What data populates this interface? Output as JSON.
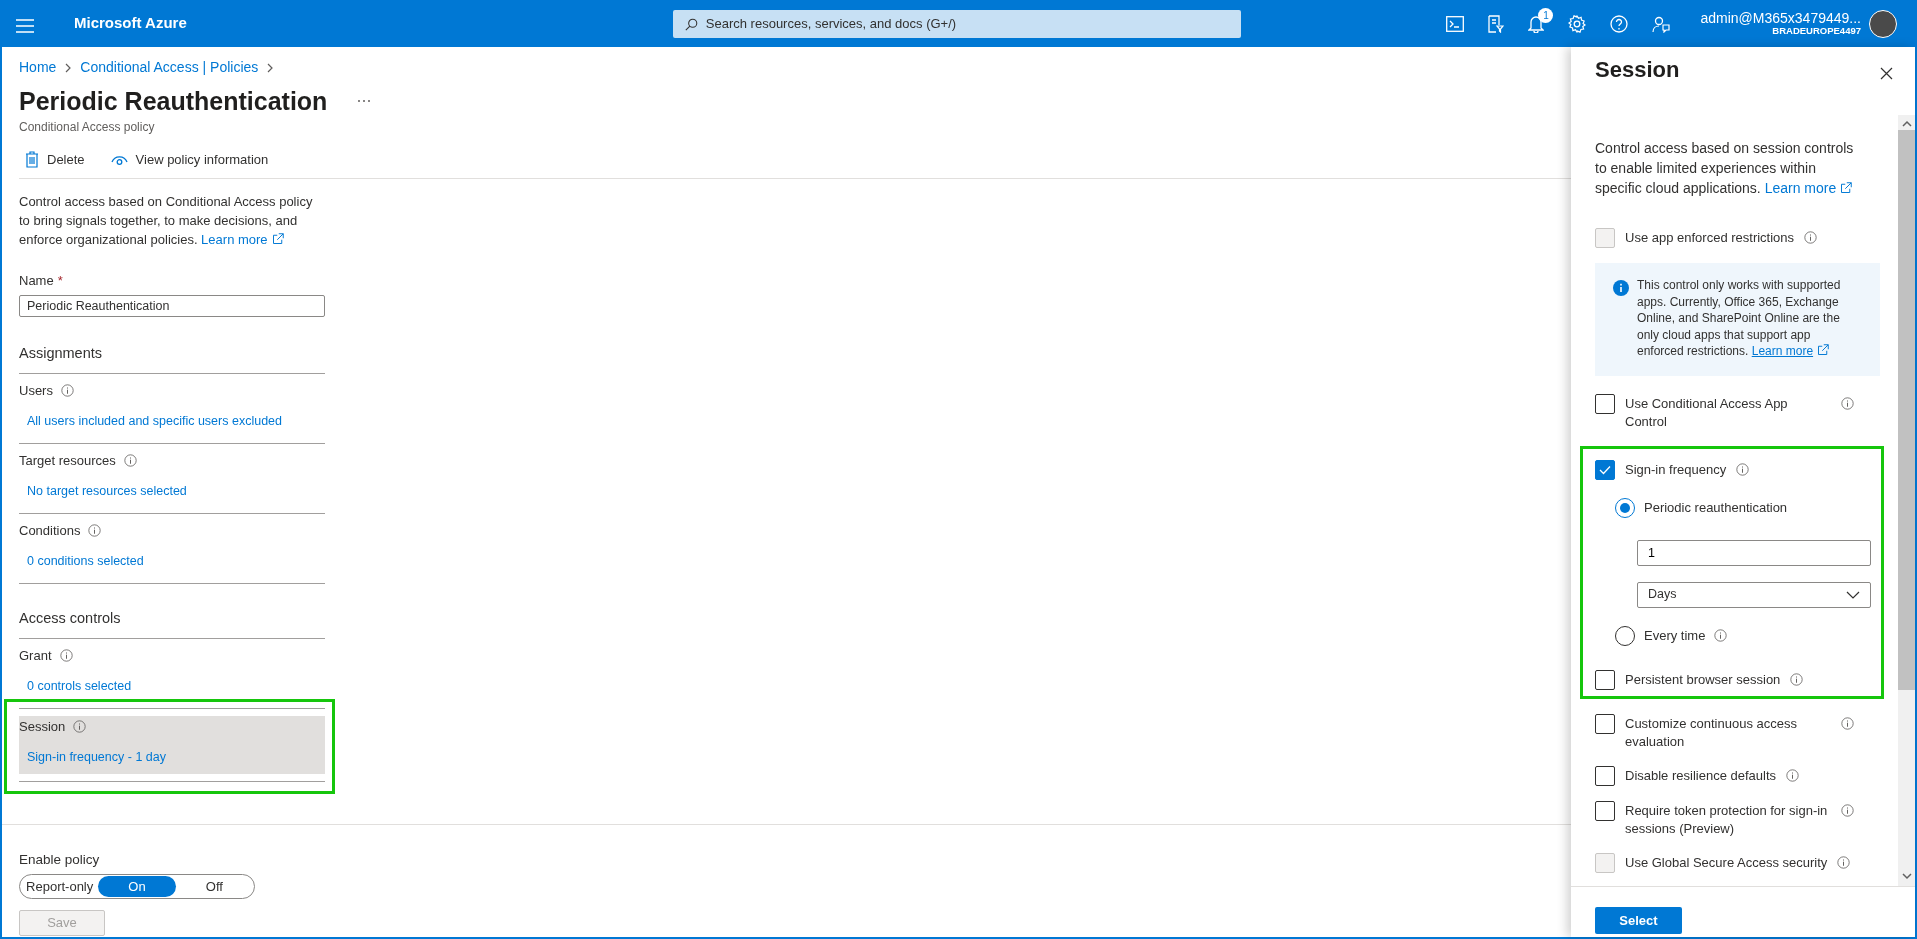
{
  "topbar": {
    "brand": "Microsoft Azure",
    "search": {
      "placeholder": "Search resources, services, and docs (G+/)"
    },
    "notification_count": "1",
    "account": {
      "name": "admin@M365x3479449...",
      "tenant": "BRADEUROPE4497"
    }
  },
  "breadcrumb": [
    {
      "label": "Home"
    },
    {
      "label": "Conditional Access | Policies"
    }
  ],
  "page": {
    "title": "Periodic Reauthentication",
    "subtitle": "Conditional Access policy"
  },
  "toolbar": [
    {
      "kind": "delete",
      "label": "Delete"
    },
    {
      "kind": "view",
      "label": "View policy information"
    }
  ],
  "description": {
    "text": "Control access based on Conditional Access policy to bring signals together, to make decisions, and enforce organizational policies. ",
    "link": "Learn more"
  },
  "name_field": {
    "label": "Name",
    "required_mark": "*",
    "value": "Periodic Reauthentication"
  },
  "sections": [
    {
      "heading": "Assignments",
      "items": [
        {
          "label": "Users",
          "value": "All users included and specific users excluded",
          "selected": false,
          "highlighted": false
        },
        {
          "label": "Target resources",
          "value": "No target resources selected",
          "selected": false,
          "highlighted": false
        },
        {
          "label": "Conditions",
          "value": "0 conditions selected",
          "selected": false,
          "highlighted": false
        }
      ]
    },
    {
      "heading": "Access controls",
      "items": [
        {
          "label": "Grant",
          "value": "0 controls selected",
          "selected": false,
          "highlighted": false
        },
        {
          "label": "Session",
          "value": "Sign-in frequency - 1 day",
          "selected": true,
          "highlighted": true
        }
      ]
    }
  ],
  "enable_policy": {
    "label": "Enable policy",
    "options": [
      {
        "label": "Report-only",
        "selected": false
      },
      {
        "label": "On",
        "selected": true
      },
      {
        "label": "Off",
        "selected": false
      }
    ]
  },
  "save_button": {
    "label": "Save",
    "disabled": true
  },
  "session_panel": {
    "title": "Session",
    "description": "Control access based on session controls to enable limited experiences within specific cloud applications. ",
    "link": "Learn more",
    "controls": [
      {
        "kind": "checkbox",
        "label": "Use app enforced restrictions",
        "checked": false,
        "disabled": true,
        "highlighted": false
      },
      {
        "kind": "notice",
        "text": "This control only works with supported apps. Currently, Office 365, Exchange Online, and SharePoint Online are the only cloud apps that support app enforced restrictions.",
        "link": "Learn more"
      },
      {
        "kind": "checkbox",
        "label": "Use Conditional Access App Control",
        "checked": false,
        "disabled": false,
        "highlighted": false
      },
      {
        "kind": "checkbox",
        "label": "Sign-in frequency",
        "checked": true,
        "disabled": false,
        "highlighted": true,
        "options": [
          {
            "label": "Periodic reauthentication",
            "selected": true,
            "value": "1",
            "unit": "Days",
            "info": false
          },
          {
            "label": "Every time",
            "selected": false,
            "info": true
          }
        ]
      },
      {
        "kind": "checkbox",
        "label": "Persistent browser session",
        "checked": false,
        "disabled": false,
        "highlighted": true
      },
      {
        "kind": "checkbox",
        "label": "Customize continuous access evaluation",
        "checked": false,
        "disabled": false,
        "highlighted": false
      },
      {
        "kind": "checkbox",
        "label": "Disable resilience defaults",
        "checked": false,
        "disabled": false,
        "highlighted": false
      },
      {
        "kind": "checkbox",
        "label": "Require token protection for sign-in sessions (Preview)",
        "checked": false,
        "disabled": false,
        "highlighted": false
      },
      {
        "kind": "checkbox",
        "label": "Use Global Secure Access security",
        "checked": false,
        "disabled": true,
        "highlighted": false
      }
    ],
    "select_button": "Select"
  }
}
